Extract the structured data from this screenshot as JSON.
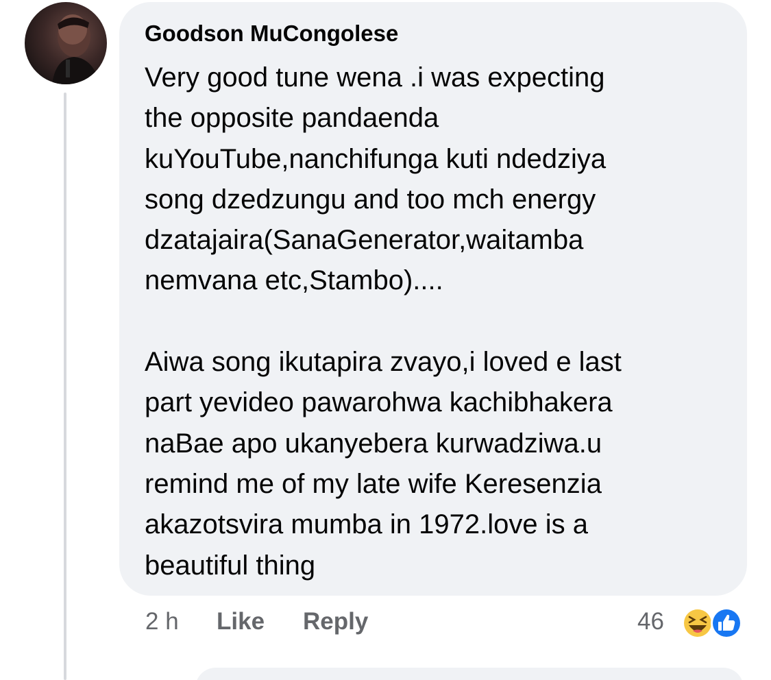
{
  "comment": {
    "author": "Goodson MuCongolese",
    "lines": [
      "Very good tune wena .i was expecting",
      "the opposite pandaenda",
      "kuYouTube,nanchifunga kuti ndedziya",
      "song dzedzungu and too mch energy",
      "dzatajaira(SanaGenerator,waitamba",
      "nemvana etc,Stambo)....",
      "",
      "Aiwa song ikutapira zvayo,i loved e last",
      "part yevideo pawarohwa kachibhakera",
      "naBae apo ukanyebera kurwadziwa.u",
      "remind me of my late wife Keresenzia",
      "akazotsvira mumba in 1972.love is a",
      "beautiful thing"
    ],
    "time": "2 h",
    "like_label": "Like",
    "reply_label": "Reply",
    "reaction_count": "46",
    "reaction_icons": [
      "laughing-emoji-icon",
      "thumbs-up-icon"
    ]
  },
  "colors": {
    "bubble": "#f0f2f5",
    "text": "#050505",
    "muted": "#65676b",
    "like_blue": "#1877f2",
    "haha_yellow": "#f7c744"
  }
}
